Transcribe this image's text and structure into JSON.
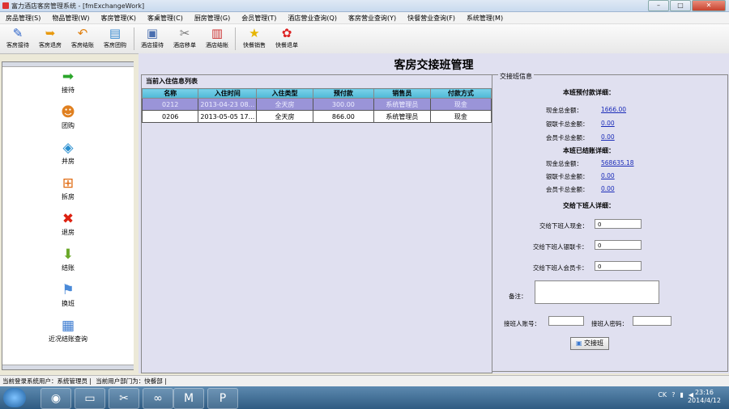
{
  "window": {
    "title": "富力酒店客房管理系统 - [fmExchangeWork]"
  },
  "menu": [
    "房品管理(S)",
    "物品管理(W)",
    "客房管理(K)",
    "客桌管理(C)",
    "厨房管理(G)",
    "会员管理(T)",
    "酒店营业查询(Q)",
    "客房营业查询(Y)",
    "快餐营业查询(F)",
    "系统管理(M)"
  ],
  "toolbar": [
    "客房接待",
    "客房退房",
    "客房结账",
    "客房团购",
    "酒店接待",
    "酒店移单",
    "酒店结帐",
    "快餐销售",
    "快餐退单"
  ],
  "sidebar": [
    "接待",
    "团购",
    "并房",
    "拆房",
    "退房",
    "结账",
    "换班",
    "近况结账查询"
  ],
  "page_title": "客房交接班管理",
  "list": {
    "caption": "当前入住信息列表",
    "headers": [
      "名称",
      "入住时间",
      "入住类型",
      "预付款",
      "销售员",
      "付款方式"
    ],
    "rows": [
      [
        "0212",
        "2013-04-23 08...",
        "全天房",
        "300.00",
        "系统管理员",
        "现金"
      ],
      [
        "0206",
        "2013-05-05 17...",
        "全天房",
        "866.00",
        "系统管理员",
        "现金"
      ]
    ]
  },
  "handover": {
    "legend": "交接班信息",
    "prepay_title": "本班预付款详细：",
    "prepay": [
      {
        "label": "现金总金额：",
        "value": "1666.00"
      },
      {
        "label": "银联卡总金额：",
        "value": "0.00"
      },
      {
        "label": "会员卡总金额：",
        "value": "0.00"
      }
    ],
    "settled_title": "本班已结账详细：",
    "settled": [
      {
        "label": "现金总金额：",
        "value": "568635.18"
      },
      {
        "label": "银联卡总金额：",
        "value": "0.00"
      },
      {
        "label": "会员卡总金额：",
        "value": "0.00"
      }
    ],
    "next_title": "交给下班人详细：",
    "next_cash_label": "交给下班人现金：",
    "next_cash": "0",
    "next_union_label": "交给下班人银联卡：",
    "next_union": "0",
    "next_member_label": "交给下班人会员卡：",
    "next_member": "0",
    "remark_label": "备注：",
    "account_label": "接班人账号：",
    "password_label": "接班人密码：",
    "submit_label": "交接班"
  },
  "status": {
    "user": "当前登录系统用户：系统管理员 | ",
    "dept": "当前用户部门为：快餐部 |"
  },
  "clock": {
    "time": "23:16",
    "date": "2014/4/12"
  },
  "tray_label": "CK"
}
